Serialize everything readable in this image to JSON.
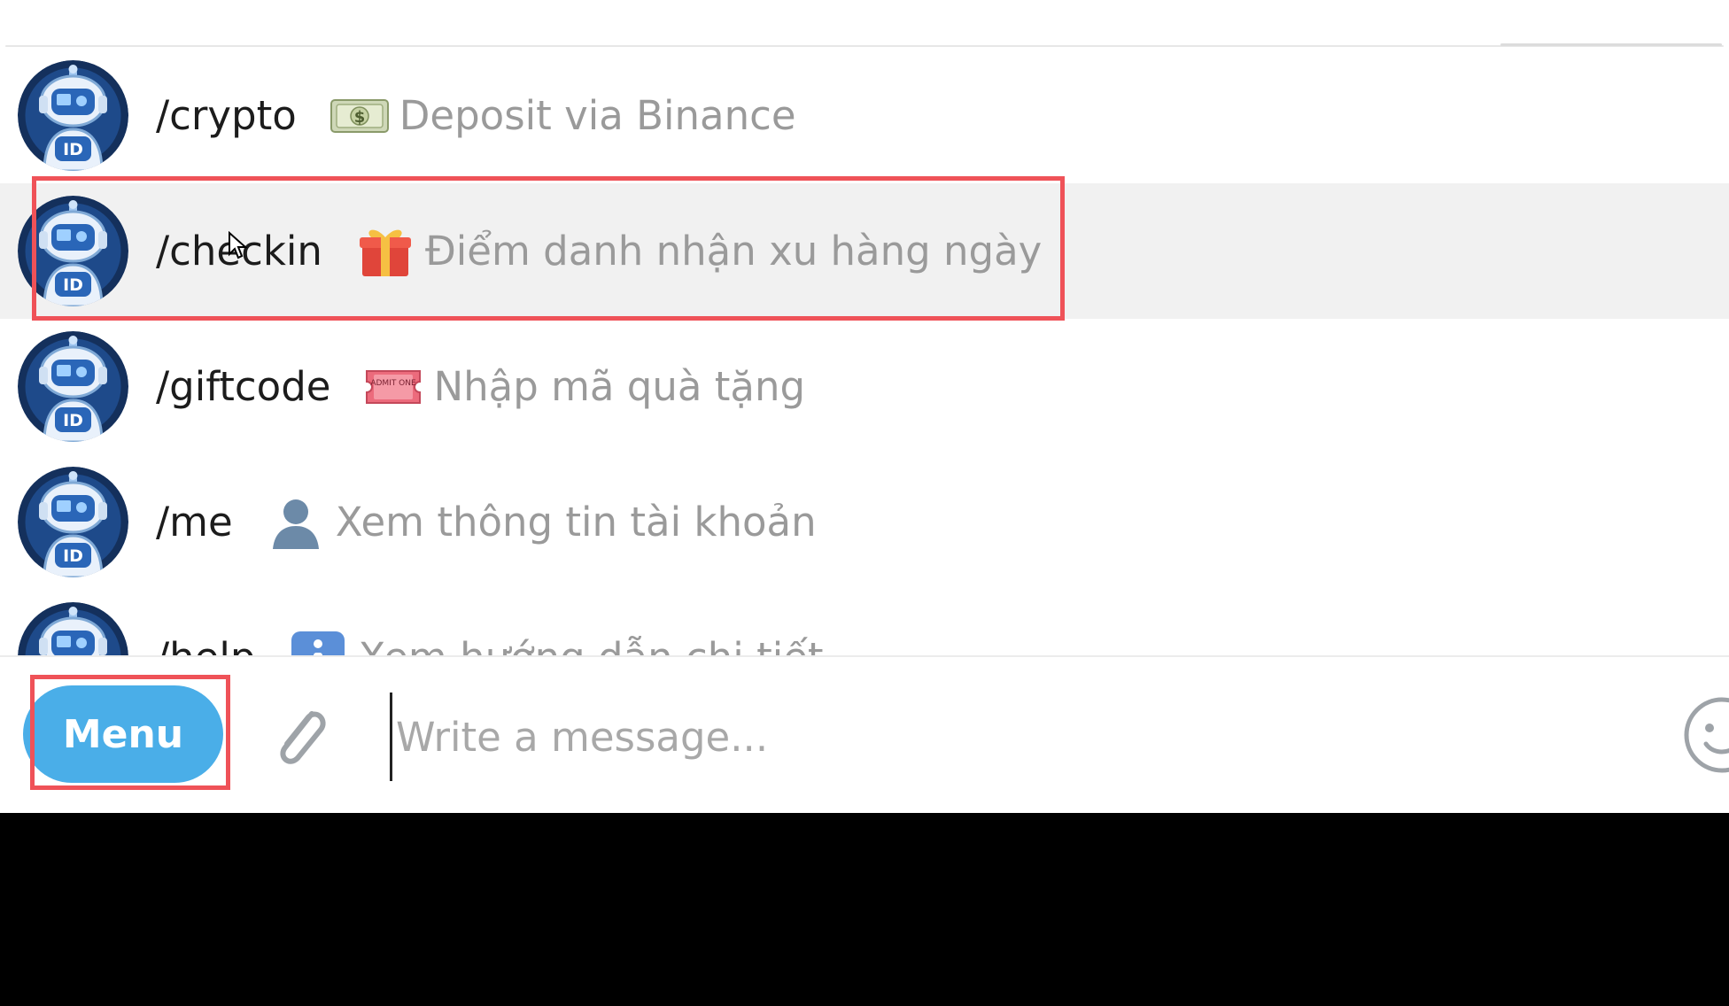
{
  "commands": [
    {
      "name": "/crypto",
      "icon": "dollar-banknote-icon",
      "description": "Deposit via Binance"
    },
    {
      "name": "/checkin",
      "icon": "gift-icon",
      "description": "Điểm danh nhận xu hàng ngày"
    },
    {
      "name": "/giftcode",
      "icon": "admit-one-ticket-icon",
      "ticket_text": "ADMIT ONE",
      "description": "Nhập mã quà tặng"
    },
    {
      "name": "/me",
      "icon": "person-silhouette-icon",
      "description": "Xem thông tin tài khoản"
    },
    {
      "name": "/help",
      "icon": "info-icon",
      "description": "Xem hướng dẫn chi tiết"
    }
  ],
  "selected_command": "/checkin",
  "bot_avatar": {
    "badge_text": "ID"
  },
  "composer": {
    "menu_label": "Menu",
    "input_placeholder": "Write a message...",
    "input_value": ""
  },
  "colors": {
    "menu_button": "#4aaee8",
    "highlight_box": "#ef5258",
    "selected_row": "#f1f1f1",
    "description_text": "#9a9a9a"
  }
}
